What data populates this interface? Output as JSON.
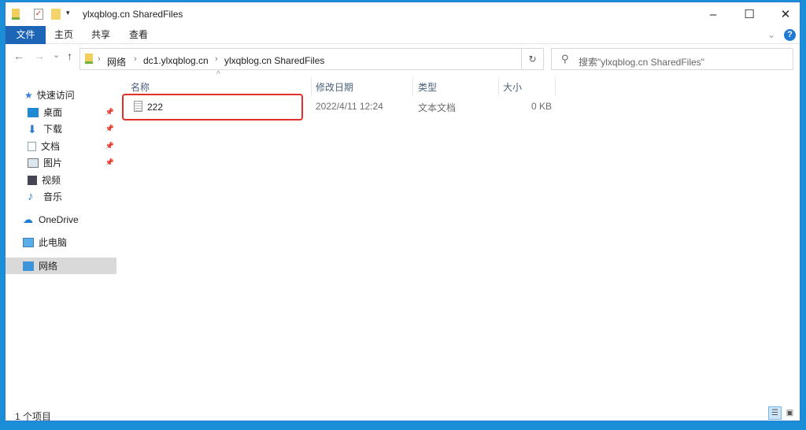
{
  "window": {
    "title": "ylxqblog.cn SharedFiles",
    "minimize": "–",
    "maximize": "☐",
    "close": "✕"
  },
  "ribbon": {
    "tabs": [
      "文件",
      "主页",
      "共享",
      "查看"
    ],
    "expand": "⌄",
    "help": "?"
  },
  "address": {
    "crumbs": [
      "网络",
      "dc1.ylxqblog.cn",
      "ylxqblog.cn SharedFiles"
    ],
    "refresh": "↻",
    "search_placeholder": "搜索\"ylxqblog.cn SharedFiles\""
  },
  "nav": {
    "back": "←",
    "forward": "→",
    "recent": "⌄",
    "up": "↑"
  },
  "sidebar": {
    "quick_access": "快速访问",
    "items": [
      "桌面",
      "下载",
      "文档",
      "图片",
      "视频",
      "音乐"
    ],
    "onedrive": "OneDrive",
    "this_pc": "此电脑",
    "network": "网络"
  },
  "columns": [
    "名称",
    "修改日期",
    "类型",
    "大小"
  ],
  "sort_indicator": "^",
  "files": [
    {
      "name": "222",
      "modified": "2022/4/11 12:24",
      "type": "文本文档",
      "size": "0 KB"
    }
  ],
  "status": {
    "count": "1 个项目"
  },
  "colors": {
    "accent": "#1d65b6",
    "highlight": "#e0302b",
    "desktop": "#1a8fd8"
  }
}
